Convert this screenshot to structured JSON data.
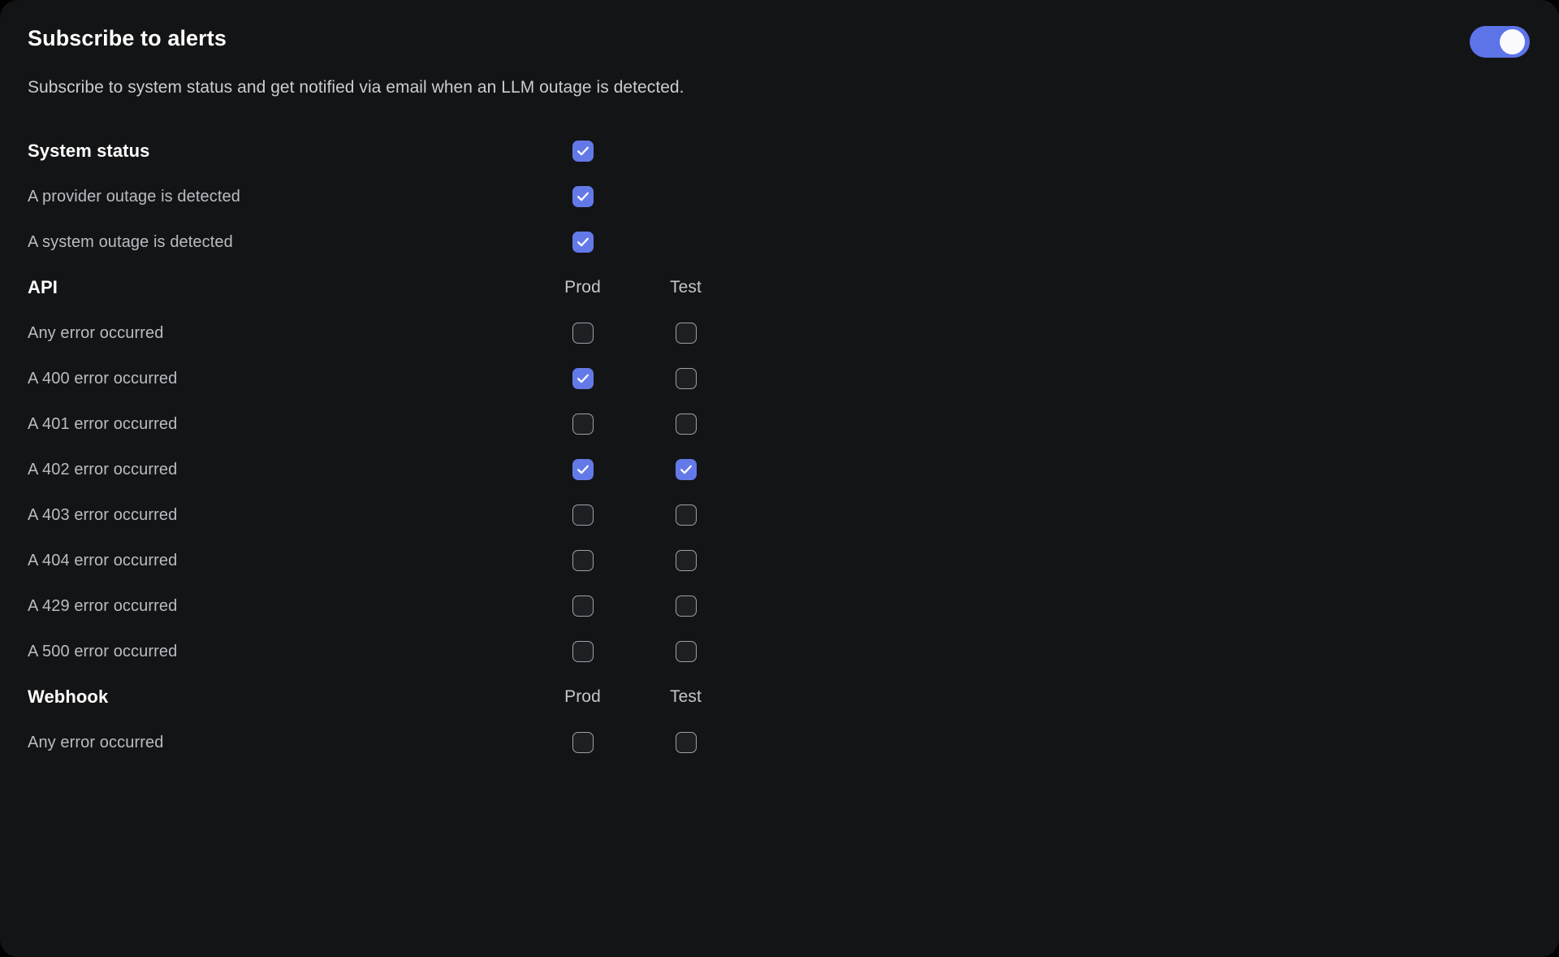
{
  "panel": {
    "title": "Subscribe to alerts",
    "description": "Subscribe to system status and get notified via email when an LLM outage is detected.",
    "toggle": {
      "name": "subscribe-to-alerts-toggle",
      "state": "on"
    }
  },
  "colors": {
    "accent": "#6479E8",
    "panel_bg": "#131416",
    "page_bg": "#000000",
    "label_text": "#b9bcc2",
    "heading_text": "#ffffff",
    "checkbox_border": "#9ca1a9",
    "toggle_knob": "#fbfbfd"
  },
  "sections": [
    {
      "id": "system-status",
      "heading": "System status",
      "columns": [],
      "heading_checkbox": {
        "checked": true
      },
      "rows": [
        {
          "label": "A provider outage is detected",
          "cells": [
            {
              "checked": true
            }
          ]
        },
        {
          "label": "A system outage is detected",
          "cells": [
            {
              "checked": true
            }
          ]
        }
      ]
    },
    {
      "id": "api",
      "heading": "API",
      "columns": [
        "Prod",
        "Test"
      ],
      "rows": [
        {
          "label": "Any error occurred",
          "cells": [
            {
              "checked": false
            },
            {
              "checked": false
            }
          ]
        },
        {
          "label": "A 400 error occurred",
          "cells": [
            {
              "checked": true
            },
            {
              "checked": false
            }
          ]
        },
        {
          "label": "A 401 error occurred",
          "cells": [
            {
              "checked": false
            },
            {
              "checked": false
            }
          ]
        },
        {
          "label": "A 402 error occurred",
          "cells": [
            {
              "checked": true
            },
            {
              "checked": true
            }
          ]
        },
        {
          "label": "A 403 error occurred",
          "cells": [
            {
              "checked": false
            },
            {
              "checked": false
            }
          ]
        },
        {
          "label": "A 404 error occurred",
          "cells": [
            {
              "checked": false
            },
            {
              "checked": false
            }
          ]
        },
        {
          "label": "A 429 error occurred",
          "cells": [
            {
              "checked": false
            },
            {
              "checked": false
            }
          ]
        },
        {
          "label": "A 500 error occurred",
          "cells": [
            {
              "checked": false
            },
            {
              "checked": false
            }
          ]
        }
      ]
    },
    {
      "id": "webhook",
      "heading": "Webhook",
      "columns": [
        "Prod",
        "Test"
      ],
      "rows": [
        {
          "label": "Any error occurred",
          "cells": [
            {
              "checked": false
            },
            {
              "checked": false
            }
          ]
        }
      ]
    }
  ]
}
